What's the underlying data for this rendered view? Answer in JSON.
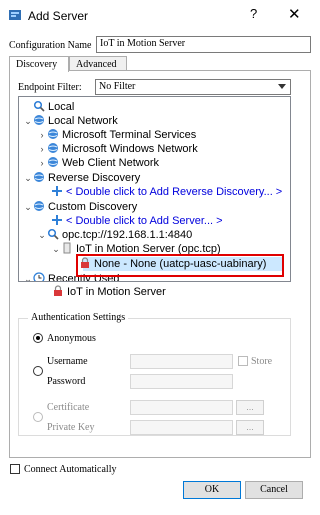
{
  "window": {
    "title": "Add Server",
    "help": "?",
    "close": "✕"
  },
  "config": {
    "label": "Configuration Name",
    "value": "IoT in Motion Server"
  },
  "tabs": [
    {
      "label": "Discovery"
    },
    {
      "label": "Advanced"
    }
  ],
  "filter": {
    "label": "Endpoint Filter:",
    "value": "No Filter"
  },
  "tree": {
    "local": "Local",
    "local_network": "Local Network",
    "mts": "Microsoft Terminal Services",
    "mwn": "Microsoft Windows Network",
    "wcn": "Web Client Network",
    "reverse": "Reverse Discovery",
    "reverse_add": "< Double click to Add Reverse Discovery... >",
    "custom": "Custom Discovery",
    "custom_add": "< Double click to Add Server... >",
    "opc_url": "opc.tcp://192.168.1.1:4840",
    "server": "IoT in Motion Server (opc.tcp)",
    "endpoint": "None - None (uatcp-uasc-uabinary)",
    "recent": "Recently Used",
    "recent_server": "IoT in Motion Server"
  },
  "auth": {
    "title": "Authentication Settings",
    "anonymous": "Anonymous",
    "username": "Username",
    "password": "Password",
    "store": "Store",
    "certificate": "Certificate",
    "private_key": "Private Key",
    "browse": "..."
  },
  "footer": {
    "auto_connect": "Connect Automatically",
    "ok": "OK",
    "cancel": "Cancel"
  }
}
